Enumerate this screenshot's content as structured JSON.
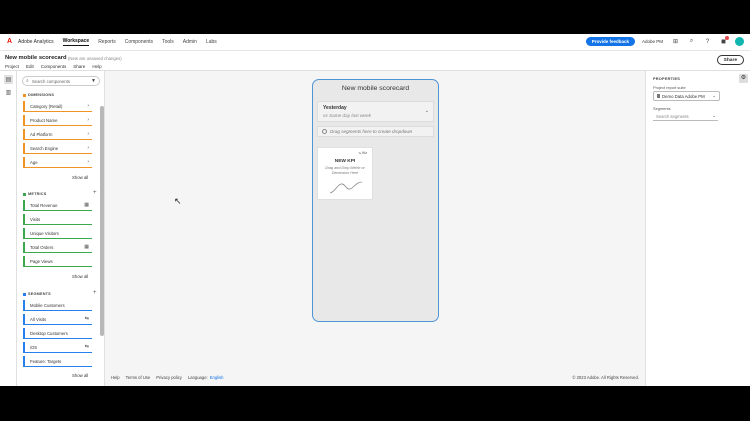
{
  "topnav": {
    "app_name": "Adobe Analytics",
    "links": [
      "Workspace",
      "Reports",
      "Components",
      "Tools",
      "Admin",
      "Labs"
    ],
    "feedback_label": "Provide feedback",
    "org_name": "Adobe PM"
  },
  "project": {
    "title": "New mobile scorecard",
    "unsaved": "(New are unsaved changes)",
    "menus": [
      "Project",
      "Edit",
      "Components",
      "Share",
      "Help"
    ],
    "share_label": "Share"
  },
  "left_panel": {
    "search_placeholder": "Search components",
    "dimensions": {
      "header": "DIMENSIONS",
      "color": "#f29423",
      "items": [
        "Category (Retail)",
        "Product Name",
        "Ad Platform",
        "Search Engine",
        "Age"
      ],
      "show_all": "Show all"
    },
    "metrics": {
      "header": "METRICS",
      "color": "#3da74e",
      "items": [
        "Total Revenue",
        "Visits",
        "Unique Visitors",
        "Total Orders",
        "Page Views"
      ],
      "show_all": "Show all"
    },
    "segments": {
      "header": "SEGMENTS",
      "color": "#2680eb",
      "items": [
        "Mobile Customers",
        "All Visits",
        "Desktop Customers",
        "iOS",
        "Feature: Targets"
      ],
      "show_all": "Show all"
    }
  },
  "scorecard": {
    "title": "New mobile scorecard",
    "date_title": "Yesterday",
    "date_compare": "vs Same day last week",
    "drop_hint": "Drag segments here to create dropdown",
    "kpi_link": "Viz",
    "kpi_title": "NEW KPI",
    "kpi_desc": "Drag and Drop Metric or Dimension Here"
  },
  "right_panel": {
    "title": "PROPERTIES",
    "report_suite_label": "Project report suite",
    "report_suite_value": "Demo Data Adobe PM",
    "segments_label": "Segments",
    "segments_placeholder": "Search segments"
  },
  "footer": {
    "help": "Help",
    "terms": "Terms of Use",
    "privacy": "Privacy policy",
    "language_label": "Language:",
    "language_value": "English",
    "copyright": "© 2023 Adobe. All Rights Reserved."
  },
  "colors": {
    "accent": "#1473e6",
    "phone_border": "#4f95d6"
  }
}
